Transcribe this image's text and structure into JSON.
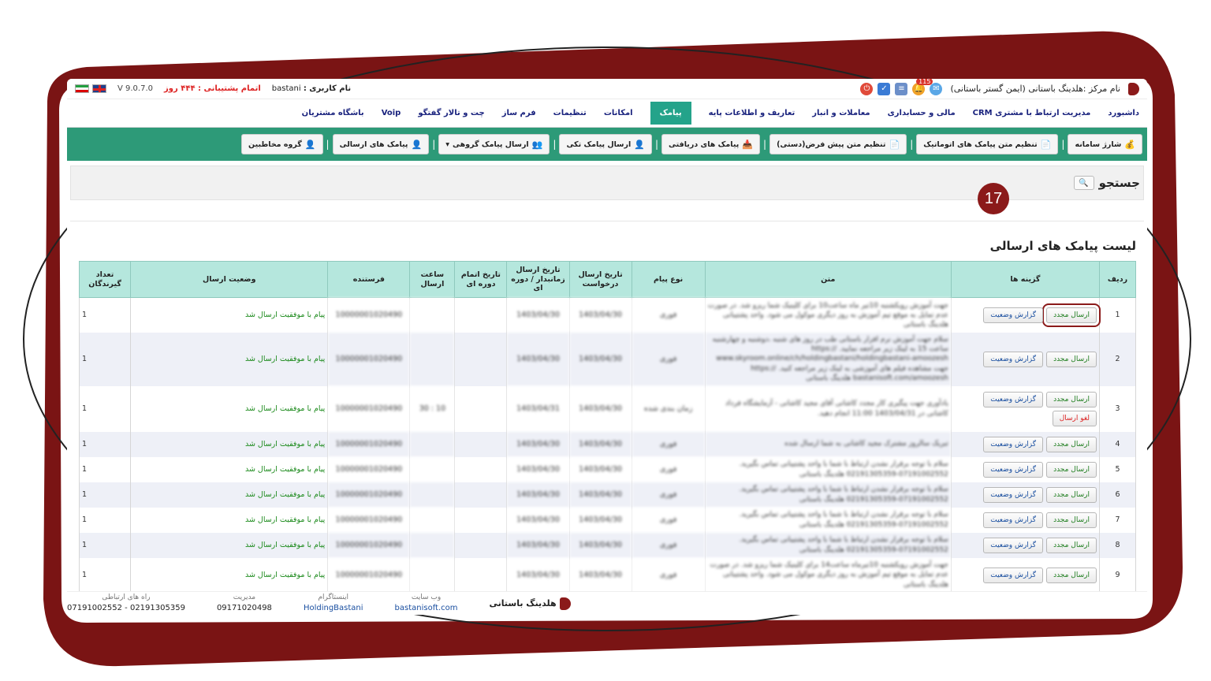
{
  "app": {
    "center_label": "نام مرکز :هلدینگ باستانی (ایمن گستر باستانی)",
    "notification_count": "115",
    "user_label": "نام کاربری :",
    "username": "bastani",
    "support_text": "اتمام پشتیبانی : ۴۴۴ روز",
    "version": "V 9.0.7.0"
  },
  "menu": [
    {
      "label": "داشبورد"
    },
    {
      "label": "مدیریت ارتباط با مشتری CRM"
    },
    {
      "label": "مالی و حسابداری"
    },
    {
      "label": "معاملات و انبار"
    },
    {
      "label": "تعاریف و اطلاعات پایه"
    },
    {
      "label": "پیامک",
      "active": true
    },
    {
      "label": "امکانات"
    },
    {
      "label": "تنظیمات"
    },
    {
      "label": "فرم ساز"
    },
    {
      "label": "چت و تالار گفتگو"
    },
    {
      "label": "Voip"
    },
    {
      "label": "باشگاه مشتریان"
    }
  ],
  "toolbar": [
    {
      "label": "شارژ سامانه",
      "icon": "coin-icon"
    },
    {
      "label": "تنظیم متن پیامک های اتوماتیک",
      "icon": "doc-icon"
    },
    {
      "label": "تنظیم متن پیش فرض(دستی)",
      "icon": "doc-icon"
    },
    {
      "label": "پیامک های دریافتی",
      "icon": "inbox-icon"
    },
    {
      "label": "ارسال پیامک تکی",
      "icon": "user-icon"
    },
    {
      "label": "ارسال پیامک گروهی",
      "icon": "group-icon",
      "dropdown": true
    },
    {
      "label": "پیامک های ارسالی",
      "icon": "user-icon"
    },
    {
      "label": "گروه مخاطبین",
      "icon": "user-icon"
    }
  ],
  "search": {
    "title": "جستجو"
  },
  "list": {
    "title": "لیست پیامک های ارسالی",
    "step_number": "17",
    "headers": {
      "row": "ردیف",
      "options": "گزینه ها",
      "text": "متن",
      "type": "نوع پیام",
      "req_date": "تاریخ ارسال درخواست",
      "sched_date": "تاریخ ارسال زمانبدار / دوره ای",
      "period_end": "تاریخ اتمام دوره ای",
      "send_time": "ساعت ارسال",
      "sender": "فرستنده",
      "status": "وضعیت ارسال",
      "recipients": "تعداد گیرندگان"
    },
    "buttons": {
      "resend": "ارسال مجدد",
      "report": "گزارش وضعیت",
      "cancel": "لغو ارسال"
    },
    "rows": [
      {
        "n": "1",
        "text": "جهت آموزش رویکشنبه 10تیر ماه ساعت10 برای کلینیک شما ریزو شد. در صورت عدم تمایل به موقع تیم آموزش به روز دیگری موکول می شود. واحد پشتیبانی هلدینگ باستانی",
        "type": "فوری",
        "req": "1403/04/30",
        "sched": "1403/04/30",
        "end": "",
        "time": "",
        "sender": "10000001020490",
        "status": "پیام با موفقیت ارسال شد",
        "count": "1",
        "cancel": false
      },
      {
        "n": "2",
        "text": "سلام جهت آموزش نرم افزار باستانی طب در روز های شنبه ،دوشنبه و چهارشنبه ساعت 15 به لینک زیر مراجعه نمایید. https:// www.skyroom.online/ch/holdingbastani/holdingbastani-amoozesh جهت مشاهده فیلم های آموزشی به لینک زیر مراجعه کنید. https:// bastanisoft.com/amoozesh هلدینگ باستانی",
        "type": "فوری",
        "req": "1403/04/30",
        "sched": "1403/04/30",
        "end": "",
        "time": "",
        "sender": "10000001020490",
        "status": "پیام با موفقیت ارسال شد",
        "count": "1",
        "cancel": false
      },
      {
        "n": "3",
        "text": "یادآوری جهت پیگیری کار مجدد کاشانی آقای مجید کاشانی - آزمایشگاه فرداد کاشانی در 1403/04/31 11:00 انجام دهید.",
        "type": "زمان بندی شده",
        "req": "1403/04/30",
        "sched": "1403/04/31",
        "end": "",
        "time": "10 : 30",
        "sender": "10000001020490",
        "status": "پیام با موفقیت ارسال شد",
        "count": "1",
        "cancel": true
      },
      {
        "n": "4",
        "text": "تبریک سالروز مشترک مجید کاشانی به شما ارسال شده",
        "type": "فوری",
        "req": "1403/04/30",
        "sched": "1403/04/30",
        "end": "",
        "time": "",
        "sender": "10000001020490",
        "status": "پیام با موفقیت ارسال شد",
        "count": "1",
        "cancel": false
      },
      {
        "n": "5",
        "text": "سلام با توجه برقرار نشدن ارتباط با شما با واحد پشتیبانی تماس بگیرید. 07191002552-02191305359 هلدینگ باستانی",
        "type": "فوری",
        "req": "1403/04/30",
        "sched": "1403/04/30",
        "end": "",
        "time": "",
        "sender": "10000001020490",
        "status": "پیام با موفقیت ارسال شد",
        "count": "1",
        "cancel": false
      },
      {
        "n": "6",
        "text": "سلام با توجه برقرار نشدن ارتباط با شما با واحد پشتیبانی تماس بگیرید. 07191002552-02191305359 هلدینگ باستانی",
        "type": "فوری",
        "req": "1403/04/30",
        "sched": "1403/04/30",
        "end": "",
        "time": "",
        "sender": "10000001020490",
        "status": "پیام با موفقیت ارسال شد",
        "count": "1",
        "cancel": false
      },
      {
        "n": "7",
        "text": "سلام با توجه برقرار نشدن ارتباط با شما با واحد پشتیبانی تماس بگیرید. 07191002552-02191305359 هلدینگ باستانی",
        "type": "فوری",
        "req": "1403/04/30",
        "sched": "1403/04/30",
        "end": "",
        "time": "",
        "sender": "10000001020490",
        "status": "پیام با موفقیت ارسال شد",
        "count": "1",
        "cancel": false
      },
      {
        "n": "8",
        "text": "سلام با توجه برقرار نشدن ارتباط با شما با واحد پشتیبانی تماس بگیرید. 07191002552-02191305359 هلدینگ باستانی",
        "type": "فوری",
        "req": "1403/04/30",
        "sched": "1403/04/30",
        "end": "",
        "time": "",
        "sender": "10000001020490",
        "status": "پیام با موفقیت ارسال شد",
        "count": "1",
        "cancel": false
      },
      {
        "n": "9",
        "text": "جهت آموزش رویکشنبه 10تیرماه ساعت14 برای کلینیک شما ریزو شد. در صورت عدم تمایل به موقع تیم آموزش به روز دیگری موکول می شود. واحد پشتیبانی هلدینگ باستانی",
        "type": "فوری",
        "req": "1403/04/30",
        "sched": "1403/04/30",
        "end": "",
        "time": "",
        "sender": "10000001020490",
        "status": "پیام با موفقیت ارسال شد",
        "count": "1",
        "cancel": false
      }
    ]
  },
  "footer": {
    "brand": "هلدینگ باستانی",
    "website_label": "وب سایت",
    "website": "bastanisoft.com",
    "instagram_label": "اینستاگرام",
    "instagram": "HoldingBastani",
    "management_label": "مدیریت",
    "management": "09171020498",
    "contact_label": "راه های ارتباطی",
    "contact": "07191002552 - 02191305359"
  },
  "colors": {
    "accent": "#2d9a78",
    "frame": "#8b1a1a",
    "header_bg": "#b5e7dd"
  }
}
